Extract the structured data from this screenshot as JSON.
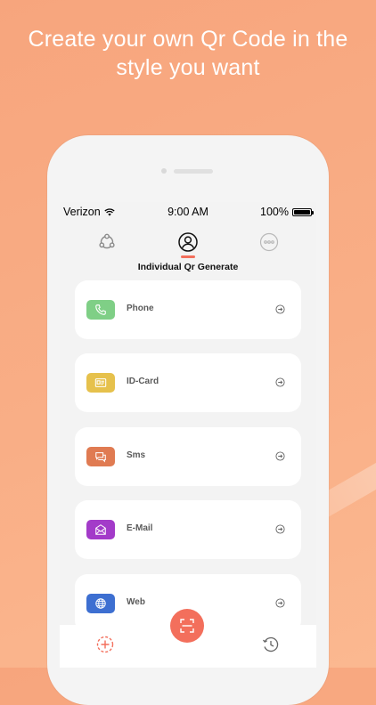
{
  "promo": {
    "line1": "Create your own Qr Code in the",
    "line2": "style you want"
  },
  "status_bar": {
    "carrier": "Verizon",
    "time": "9:00 AM",
    "battery": "100%"
  },
  "tabs": [
    {
      "icon": "share-network-icon"
    },
    {
      "icon": "user-circle-icon",
      "active": true
    },
    {
      "icon": "more-dots-icon"
    }
  ],
  "section_title": "Individual Qr Generate",
  "items": [
    {
      "label": "Phone",
      "icon": "phone-icon",
      "color": "#7fcf86"
    },
    {
      "label": "ID-Card",
      "icon": "id-card-icon",
      "color": "#e6c14c"
    },
    {
      "label": "Sms",
      "icon": "sms-icon",
      "color": "#e07b52"
    },
    {
      "label": "E-Mail",
      "icon": "email-icon",
      "color": "#a33bc9"
    },
    {
      "label": "Web",
      "icon": "globe-icon",
      "color": "#3d6fd1"
    }
  ],
  "bottom_nav": [
    {
      "icon": "add-qr-icon"
    },
    {
      "icon": "scan-icon"
    },
    {
      "icon": "history-icon"
    }
  ],
  "colors": {
    "accent": "#f36f5c",
    "background": "#f9ae86"
  }
}
